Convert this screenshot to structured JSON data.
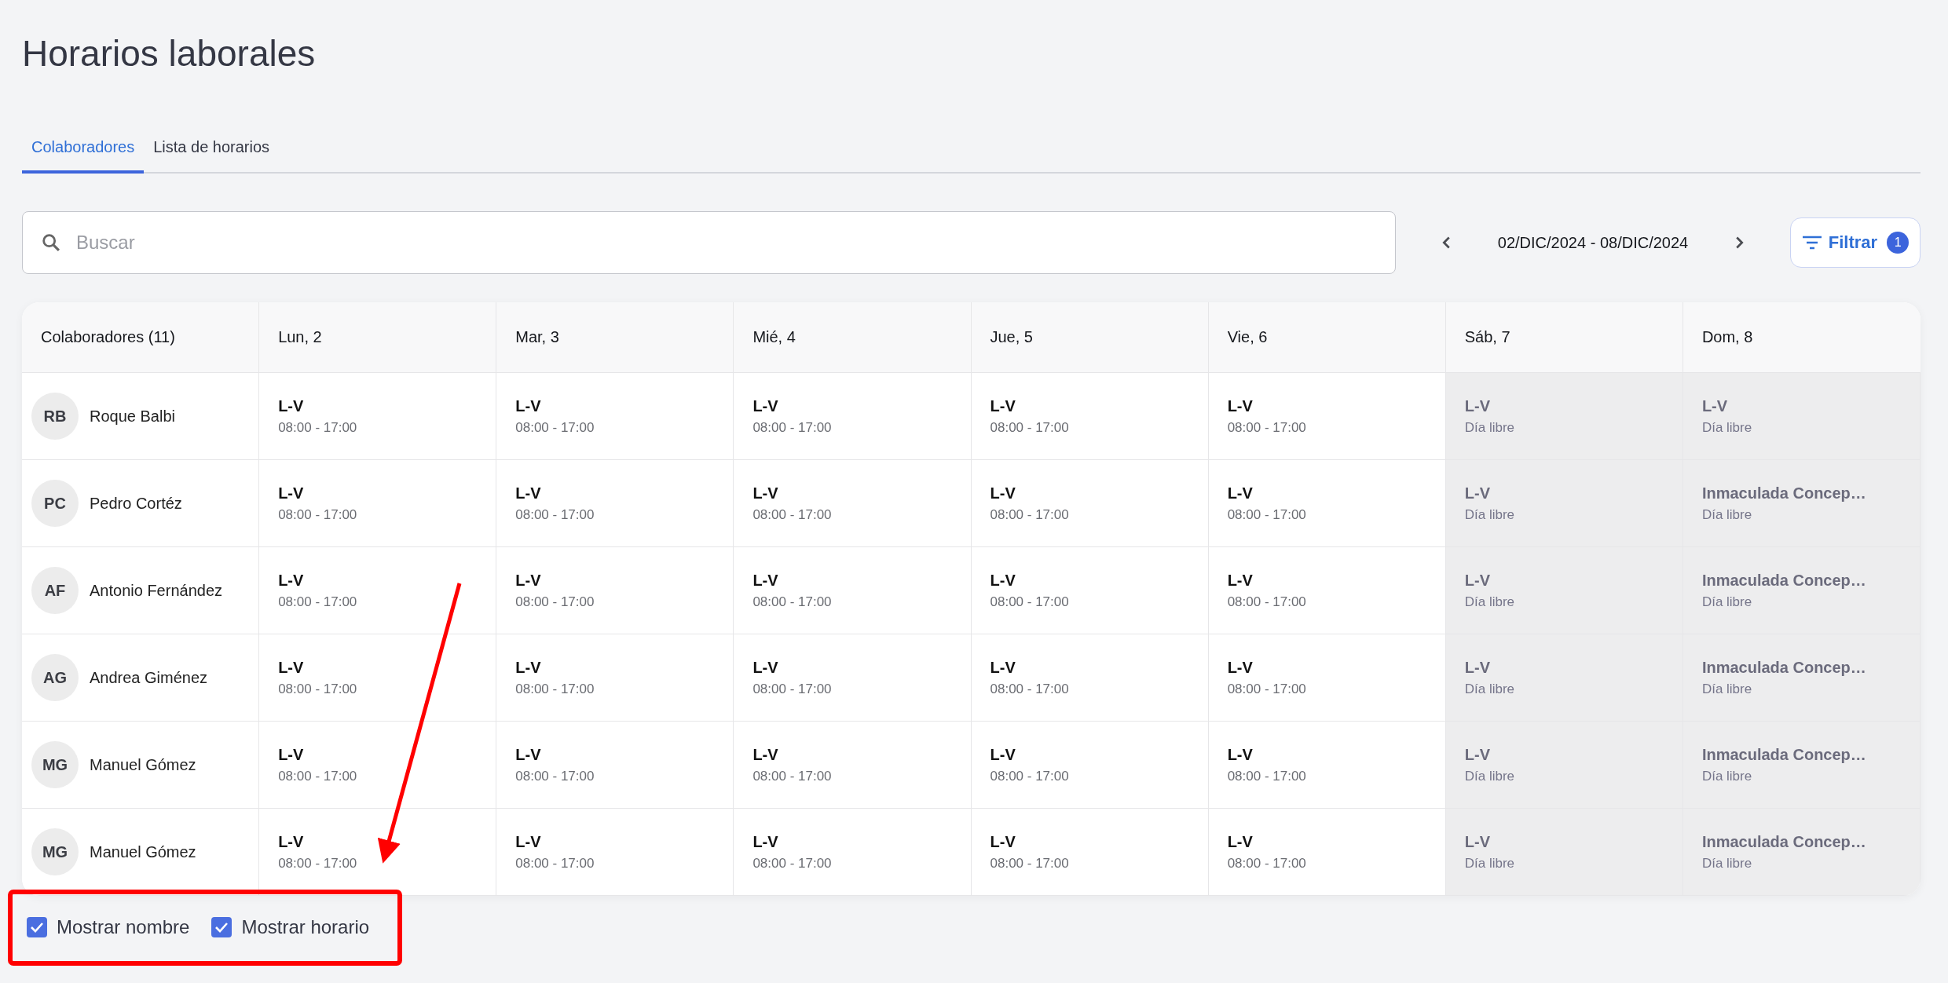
{
  "title": "Horarios laborales",
  "tabs": [
    {
      "label": "Colaboradores",
      "selected": true
    },
    {
      "label": "Lista de horarios",
      "selected": false
    }
  ],
  "search": {
    "placeholder": "Buscar"
  },
  "date_range": "02/DIC/2024 - 08/DIC/2024",
  "filter": {
    "label": "Filtrar",
    "count": "1"
  },
  "table": {
    "columns": [
      "Colaboradores (11)",
      "Lun, 2",
      "Mar, 3",
      "Mié, 4",
      "Jue, 5",
      "Vie, 6",
      "Sáb, 7",
      "Dom, 8"
    ],
    "rows": [
      {
        "cells": [
          {
            "kind": "employee",
            "initials": "RB",
            "name": "Roque Balbi"
          },
          {
            "kind": "shift",
            "title": "L-V",
            "detail": "08:00 - 17:00",
            "off": false
          },
          {
            "kind": "shift",
            "title": "L-V",
            "detail": "08:00 - 17:00",
            "off": false
          },
          {
            "kind": "shift",
            "title": "L-V",
            "detail": "08:00 - 17:00",
            "off": false
          },
          {
            "kind": "shift",
            "title": "L-V",
            "detail": "08:00 - 17:00",
            "off": false
          },
          {
            "kind": "shift",
            "title": "L-V",
            "detail": "08:00 - 17:00",
            "off": false
          },
          {
            "kind": "shift",
            "title": "L-V",
            "detail": "Día libre",
            "off": true
          },
          {
            "kind": "shift",
            "title": "L-V",
            "detail": "Día libre",
            "off": true
          }
        ]
      },
      {
        "cells": [
          {
            "kind": "employee",
            "initials": "PC",
            "name": "Pedro Cortéz"
          },
          {
            "kind": "shift",
            "title": "L-V",
            "detail": "08:00 - 17:00",
            "off": false
          },
          {
            "kind": "shift",
            "title": "L-V",
            "detail": "08:00 - 17:00",
            "off": false
          },
          {
            "kind": "shift",
            "title": "L-V",
            "detail": "08:00 - 17:00",
            "off": false
          },
          {
            "kind": "shift",
            "title": "L-V",
            "detail": "08:00 - 17:00",
            "off": false
          },
          {
            "kind": "shift",
            "title": "L-V",
            "detail": "08:00 - 17:00",
            "off": false
          },
          {
            "kind": "shift",
            "title": "L-V",
            "detail": "Día libre",
            "off": true
          },
          {
            "kind": "shift",
            "title": "Inmaculada Concep…",
            "detail": "Día libre",
            "off": true
          }
        ]
      },
      {
        "cells": [
          {
            "kind": "employee",
            "initials": "AF",
            "name": "Antonio Fernández"
          },
          {
            "kind": "shift",
            "title": "L-V",
            "detail": "08:00 - 17:00",
            "off": false
          },
          {
            "kind": "shift",
            "title": "L-V",
            "detail": "08:00 - 17:00",
            "off": false
          },
          {
            "kind": "shift",
            "title": "L-V",
            "detail": "08:00 - 17:00",
            "off": false
          },
          {
            "kind": "shift",
            "title": "L-V",
            "detail": "08:00 - 17:00",
            "off": false
          },
          {
            "kind": "shift",
            "title": "L-V",
            "detail": "08:00 - 17:00",
            "off": false
          },
          {
            "kind": "shift",
            "title": "L-V",
            "detail": "Día libre",
            "off": true
          },
          {
            "kind": "shift",
            "title": "Inmaculada Concep…",
            "detail": "Día libre",
            "off": true
          }
        ]
      },
      {
        "cells": [
          {
            "kind": "employee",
            "initials": "AG",
            "name": "Andrea Giménez"
          },
          {
            "kind": "shift",
            "title": "L-V",
            "detail": "08:00 - 17:00",
            "off": false
          },
          {
            "kind": "shift",
            "title": "L-V",
            "detail": "08:00 - 17:00",
            "off": false
          },
          {
            "kind": "shift",
            "title": "L-V",
            "detail": "08:00 - 17:00",
            "off": false
          },
          {
            "kind": "shift",
            "title": "L-V",
            "detail": "08:00 - 17:00",
            "off": false
          },
          {
            "kind": "shift",
            "title": "L-V",
            "detail": "08:00 - 17:00",
            "off": false
          },
          {
            "kind": "shift",
            "title": "L-V",
            "detail": "Día libre",
            "off": true
          },
          {
            "kind": "shift",
            "title": "Inmaculada Concep…",
            "detail": "Día libre",
            "off": true
          }
        ]
      },
      {
        "cells": [
          {
            "kind": "employee",
            "initials": "MG",
            "name": "Manuel Gómez"
          },
          {
            "kind": "shift",
            "title": "L-V",
            "detail": "08:00 - 17:00",
            "off": false
          },
          {
            "kind": "shift",
            "title": "L-V",
            "detail": "08:00 - 17:00",
            "off": false
          },
          {
            "kind": "shift",
            "title": "L-V",
            "detail": "08:00 - 17:00",
            "off": false
          },
          {
            "kind": "shift",
            "title": "L-V",
            "detail": "08:00 - 17:00",
            "off": false
          },
          {
            "kind": "shift",
            "title": "L-V",
            "detail": "08:00 - 17:00",
            "off": false
          },
          {
            "kind": "shift",
            "title": "L-V",
            "detail": "Día libre",
            "off": true
          },
          {
            "kind": "shift",
            "title": "Inmaculada Concep…",
            "detail": "Día libre",
            "off": true
          }
        ]
      },
      {
        "cells": [
          {
            "kind": "employee",
            "initials": "MG",
            "name": "Manuel Gómez"
          },
          {
            "kind": "shift",
            "title": "L-V",
            "detail": "08:00 - 17:00",
            "off": false
          },
          {
            "kind": "shift",
            "title": "L-V",
            "detail": "08:00 - 17:00",
            "off": false
          },
          {
            "kind": "shift",
            "title": "L-V",
            "detail": "08:00 - 17:00",
            "off": false
          },
          {
            "kind": "shift",
            "title": "L-V",
            "detail": "08:00 - 17:00",
            "off": false
          },
          {
            "kind": "shift",
            "title": "L-V",
            "detail": "08:00 - 17:00",
            "off": false
          },
          {
            "kind": "shift",
            "title": "L-V",
            "detail": "Día libre",
            "off": true
          },
          {
            "kind": "shift",
            "title": "Inmaculada Concep…",
            "detail": "Día libre",
            "off": true
          }
        ]
      }
    ]
  },
  "options": [
    {
      "label": "Mostrar nombre",
      "checked": true
    },
    {
      "label": "Mostrar horario",
      "checked": true
    }
  ]
}
